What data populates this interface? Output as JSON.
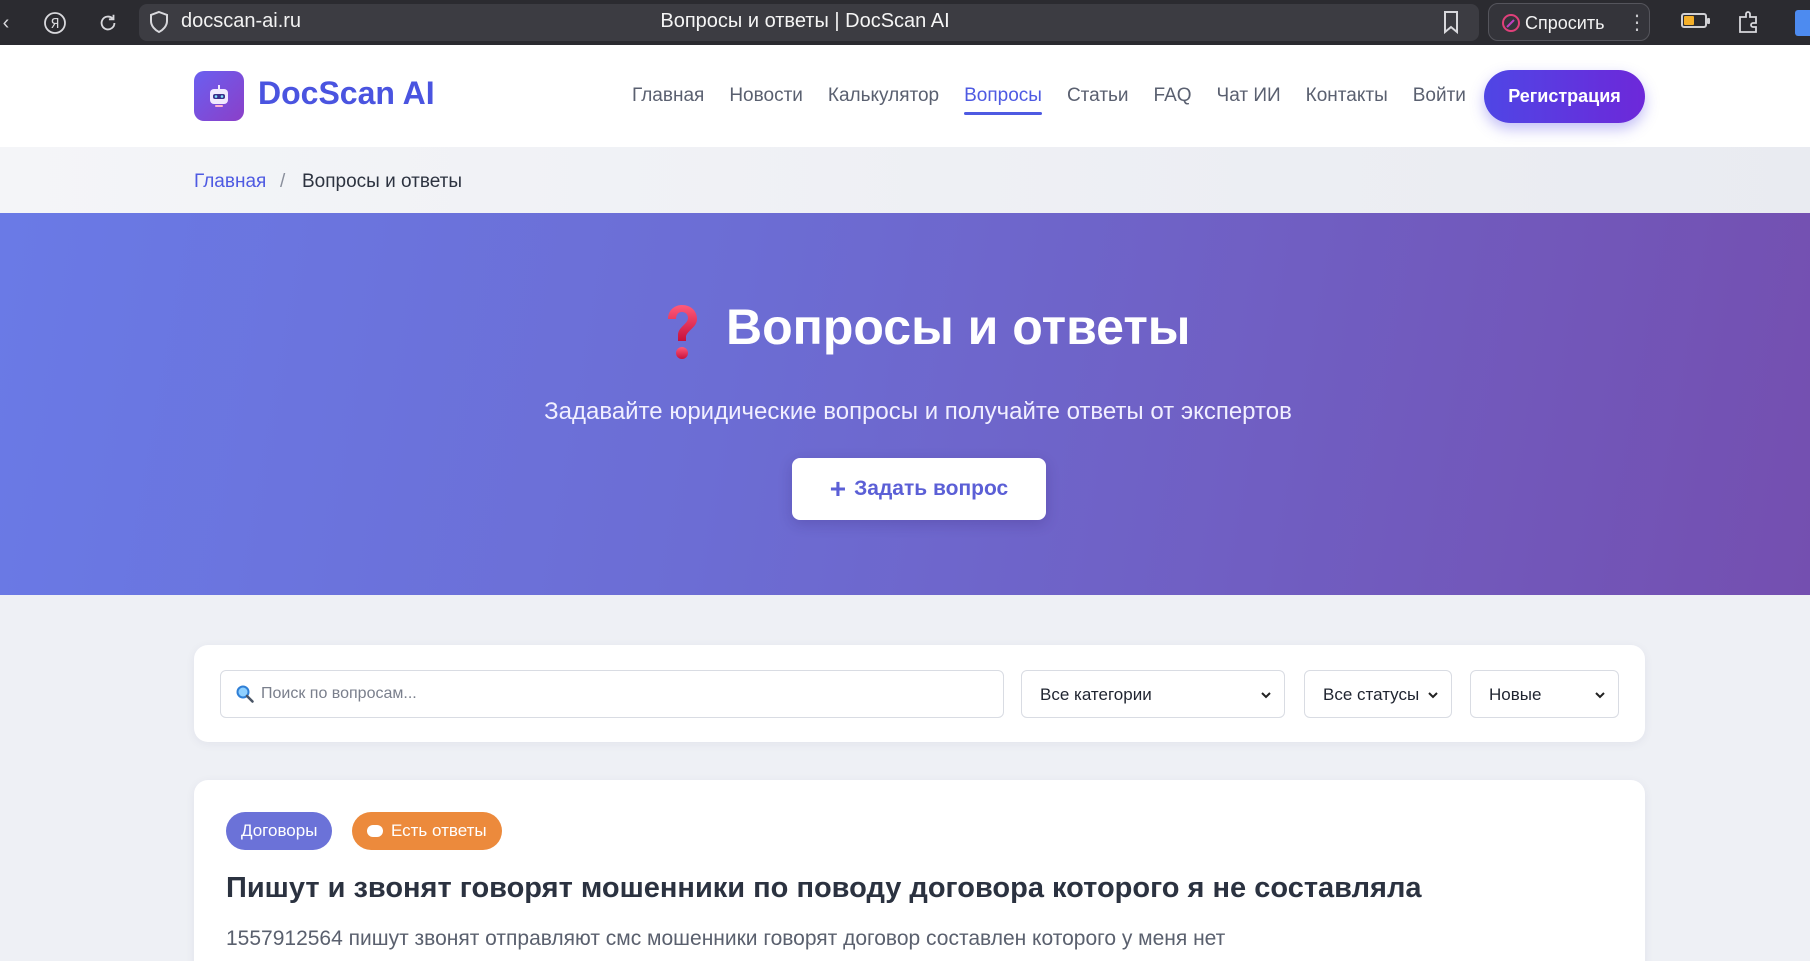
{
  "browser": {
    "url": "docscan-ai.ru",
    "page_title": "Вопросы и ответы | DocScan AI",
    "ask_label": "Спросить"
  },
  "header": {
    "brand": "DocScan AI",
    "nav": [
      "Главная",
      "Новости",
      "Калькулятор",
      "Вопросы",
      "Статьи",
      "FAQ",
      "Чат ИИ",
      "Контакты",
      "Войти"
    ],
    "active_nav": "Вопросы",
    "register_label": "Регистрация"
  },
  "breadcrumb": {
    "home": "Главная",
    "separator": "/",
    "current": "Вопросы и ответы"
  },
  "hero": {
    "title": "Вопросы и ответы",
    "subtitle": "Задавайте юридические вопросы и получайте ответы от экспертов",
    "ask_button": "Задать вопрос"
  },
  "filters": {
    "search_placeholder": "Поиск по вопросам...",
    "category_selected": "Все категории",
    "status_selected": "Все статусы",
    "sort_selected": "Новые"
  },
  "question": {
    "category": "Договоры",
    "status": "Есть ответы",
    "title": "Пишут и звонят говорят мошенники по поводу договора которого я не составляла",
    "excerpt": "1557912564 пишут звонят отправляют смс мошенники говорят договор составлен которого у меня нет"
  },
  "colors": {
    "brand": "#4a54e0",
    "accent": "#4f46e5",
    "hero_start": "#6a7ae6",
    "hero_end": "#744fb0",
    "badge_category": "#6b72d8",
    "badge_status": "#ec8a3c"
  }
}
